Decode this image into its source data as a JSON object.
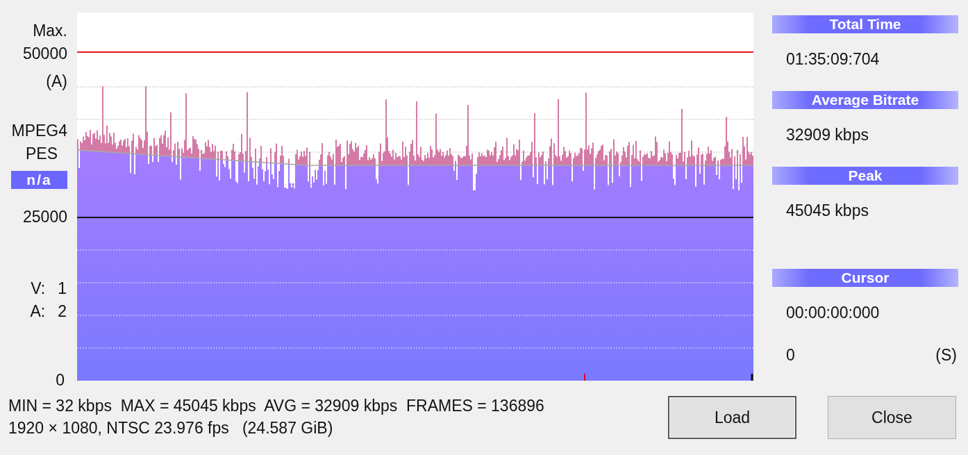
{
  "axis_labels": {
    "max_caption": "Max.",
    "max_value": "50000",
    "max_unit": "(A)",
    "format": "MPEG4",
    "stream": "PES",
    "badge": "n/a",
    "mid_value": "25000",
    "zero": "0"
  },
  "stream_counts": [
    {
      "label": "V:",
      "value": "1"
    },
    {
      "label": "A:",
      "value": "2"
    }
  ],
  "info": [
    {
      "header": "Total Time",
      "value": "01:35:09:704"
    },
    {
      "header": "Average Bitrate",
      "value": "32909 kbps"
    },
    {
      "header": "Peak",
      "value": "45045 kbps"
    }
  ],
  "cursor": {
    "header": "Cursor",
    "time": "00:00:00:000",
    "value": "0",
    "unit": "(S)"
  },
  "stats": [
    "MIN = 32 kbps  MAX = 45045 kbps  AVG = 32909 kbps  FRAMES = 136896",
    "1920 × 1080, NTSC 23.976 fps   (24.587 GiB)"
  ],
  "buttons": [
    {
      "label": "Load",
      "default": true
    },
    {
      "label": "Close",
      "default": false
    }
  ]
}
